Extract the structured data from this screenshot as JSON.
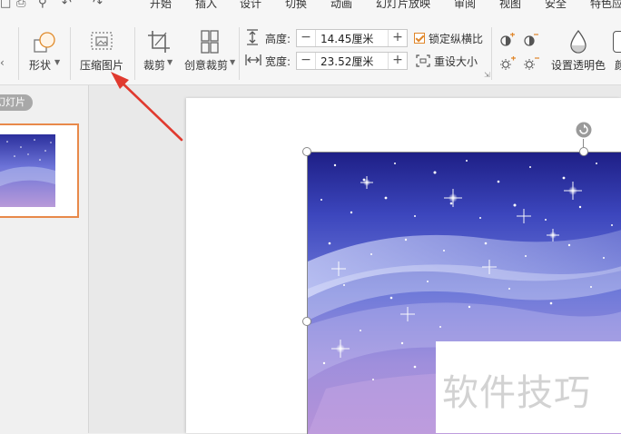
{
  "menu": {
    "tabs": [
      "开始",
      "插入",
      "设计",
      "切换",
      "动画",
      "幻灯片放映",
      "审阅",
      "视图",
      "安全",
      "特色应"
    ]
  },
  "ribbon": {
    "shape_label": "形状",
    "compress_label": "压缩图片",
    "crop_label": "裁剪",
    "creative_crop_label": "创意裁剪",
    "height_label": "高度:",
    "height_value": "14.45厘米",
    "width_label": "宽度:",
    "width_value": "23.52厘米",
    "lock_ratio_label": "锁定纵横比",
    "lock_ratio_checked": true,
    "reset_size_label": "重设大小",
    "set_transparent_label": "设置透明色",
    "partial_left": "‹",
    "partial_right": "颜"
  },
  "left_pane": {
    "tab_label": "幻灯片"
  },
  "slide": {
    "watermark_text": "软件技巧"
  },
  "colors": {
    "accent": "#e8894a",
    "arrow": "#e03a2f",
    "checkbox": "#e0862a"
  }
}
